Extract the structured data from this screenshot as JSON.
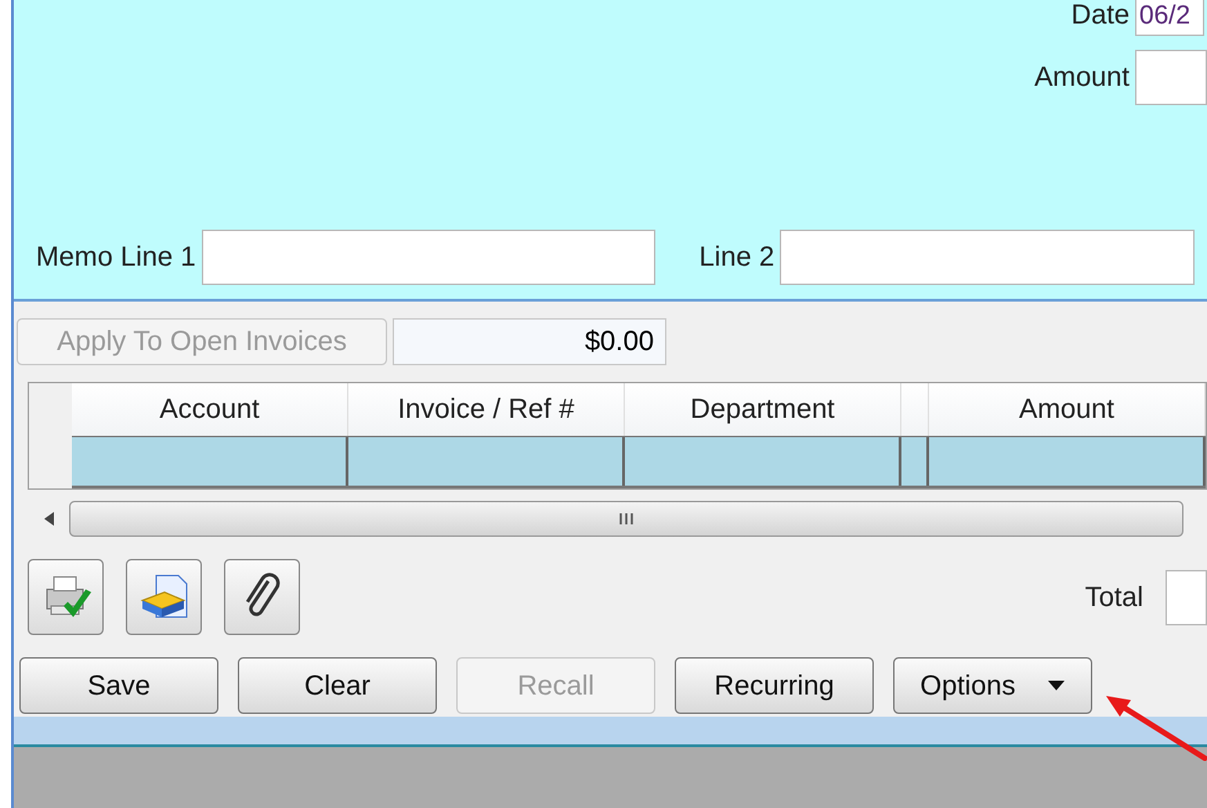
{
  "header": {
    "date": {
      "label": "Date",
      "value": "06/2"
    },
    "amount": {
      "label": "Amount"
    },
    "memo_line_1": {
      "label": "Memo Line 1"
    },
    "line_2": {
      "label": "Line 2"
    }
  },
  "apply": {
    "button": {
      "label": "Apply To Open Invoices",
      "disabled": true
    },
    "amount": "$0.00"
  },
  "table": {
    "columns": [
      "Account",
      "Invoice / Ref #",
      "Department",
      "",
      "Amount"
    ]
  },
  "toolbar": [
    {
      "kind": "print"
    },
    {
      "kind": "scan"
    },
    {
      "kind": "attach"
    }
  ],
  "total": {
    "label": "Total"
  },
  "buttons": [
    {
      "label": "Save",
      "disabled": false,
      "kind": "plain"
    },
    {
      "label": "Clear",
      "disabled": false,
      "kind": "plain"
    },
    {
      "label": "Recall",
      "disabled": true,
      "kind": "plain"
    },
    {
      "label": "Recurring",
      "disabled": false,
      "kind": "plain"
    },
    {
      "label": "Options",
      "disabled": false,
      "kind": "dropdown"
    }
  ]
}
